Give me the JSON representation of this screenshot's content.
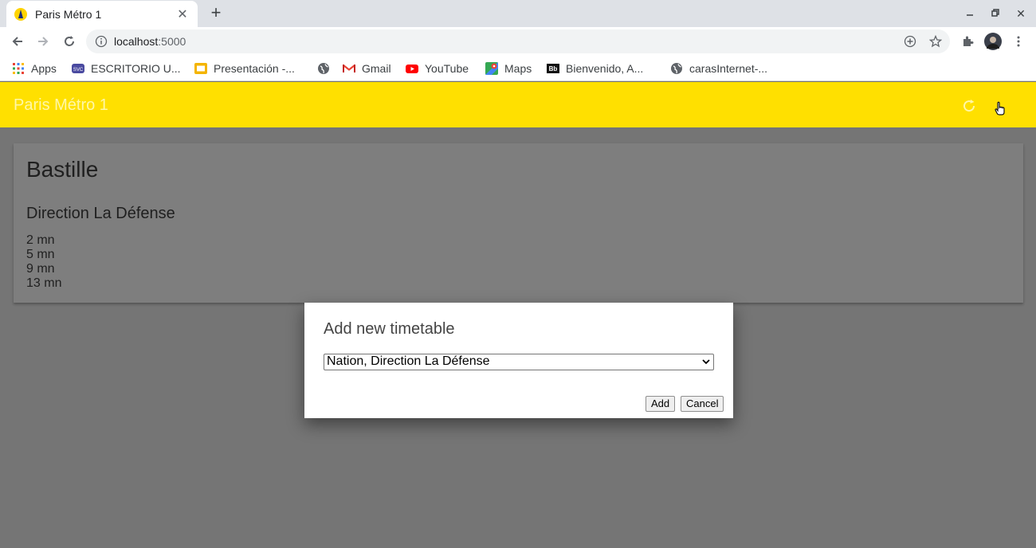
{
  "browser": {
    "tab_title": "Paris Métro 1",
    "url_host": "localhost",
    "url_port": ":5000",
    "bookmarks": [
      {
        "label": "Apps"
      },
      {
        "label": "ESCRITORIO U..."
      },
      {
        "label": "Presentación -..."
      },
      {
        "label": "Gmail"
      },
      {
        "label": "YouTube"
      },
      {
        "label": "Maps"
      },
      {
        "label": "Bienvenido, A..."
      },
      {
        "label": "carasInternet-..."
      }
    ]
  },
  "app": {
    "title": "Paris Métro 1",
    "accent_color": "#ffe000"
  },
  "card": {
    "station": "Bastille",
    "direction": "Direction La Défense",
    "times": [
      "2 mn",
      "5 mn",
      "9 mn",
      "13 mn"
    ]
  },
  "dialog": {
    "title": "Add new timetable",
    "selected_option": "Nation, Direction La Défense",
    "add_label": "Add",
    "cancel_label": "Cancel"
  }
}
